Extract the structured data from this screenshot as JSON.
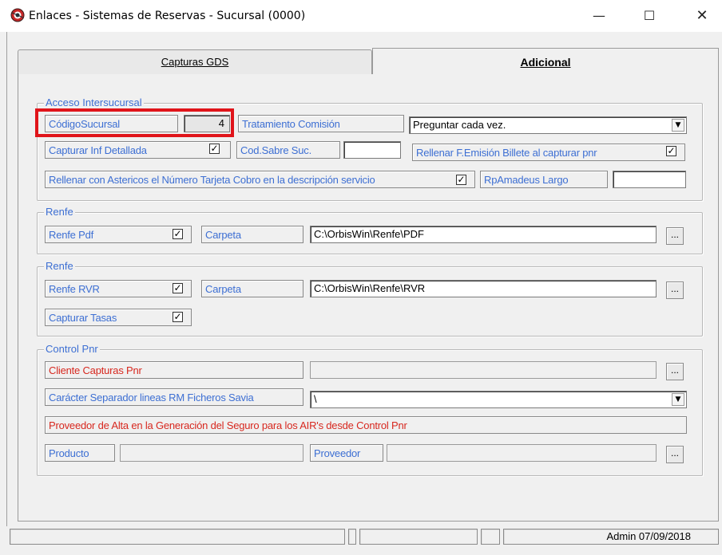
{
  "window": {
    "title": "Enlaces - Sistemas de Reservas - Sucursal (0000)",
    "minimize": "—",
    "maximize": "☐",
    "close": "✕"
  },
  "tabs": [
    {
      "label": "Capturas GDS",
      "active": false
    },
    {
      "label": "Adicional",
      "active": true
    }
  ],
  "acceso": {
    "title": "Acceso Intersucursal",
    "codigo_label": "CódigoSucursal",
    "codigo_value": "4",
    "tratamiento_label": "Tratamiento Comisión",
    "tratamiento_value": "Preguntar cada vez.",
    "capturar_label": "Capturar Inf Detallada",
    "capturar_checked": true,
    "codsabre_label": "Cod.Sabre Suc.",
    "codsabre_value": "",
    "rellenar_femision_label": "Rellenar F.Emisión Billete al capturar pnr",
    "rellenar_femision_checked": true,
    "rellenar_asteriscos_label": "Rellenar con Astericos el Número Tarjeta Cobro en la descripción servicio",
    "rellenar_asteriscos_checked": true,
    "rpamadeus_label": "RpAmadeus Largo",
    "rpamadeus_value": ""
  },
  "renfe_pdf": {
    "title": "Renfe",
    "renfe_label": "Renfe Pdf",
    "renfe_checked": true,
    "carpeta_label": "Carpeta",
    "carpeta_value": "C:\\OrbisWin\\Renfe\\PDF",
    "browse": "..."
  },
  "renfe_rvr": {
    "title": "Renfe",
    "renfe_label": "Renfe RVR",
    "renfe_checked": true,
    "carpeta_label": "Carpeta",
    "carpeta_value": "C:\\OrbisWin\\Renfe\\RVR",
    "browse": "...",
    "tasas_label": "Capturar Tasas",
    "tasas_checked": true
  },
  "control_pnr": {
    "title": "Control Pnr",
    "cliente_label": "Cliente Capturas Pnr",
    "cliente_value": "",
    "browse": "...",
    "separador_label": "Carácter Separador lineas RM Ficheros Savia",
    "separador_value": "\\",
    "proveedor_alta_label": "Proveedor de Alta en la Generación del Seguro para los AIR's desde Control Pnr",
    "producto_label": "Producto",
    "producto_value": "",
    "proveedor_label": "Proveedor",
    "proveedor_value": ""
  },
  "statusbar": {
    "user_date": "Admin 07/09/2018"
  },
  "check_mark": "✓"
}
